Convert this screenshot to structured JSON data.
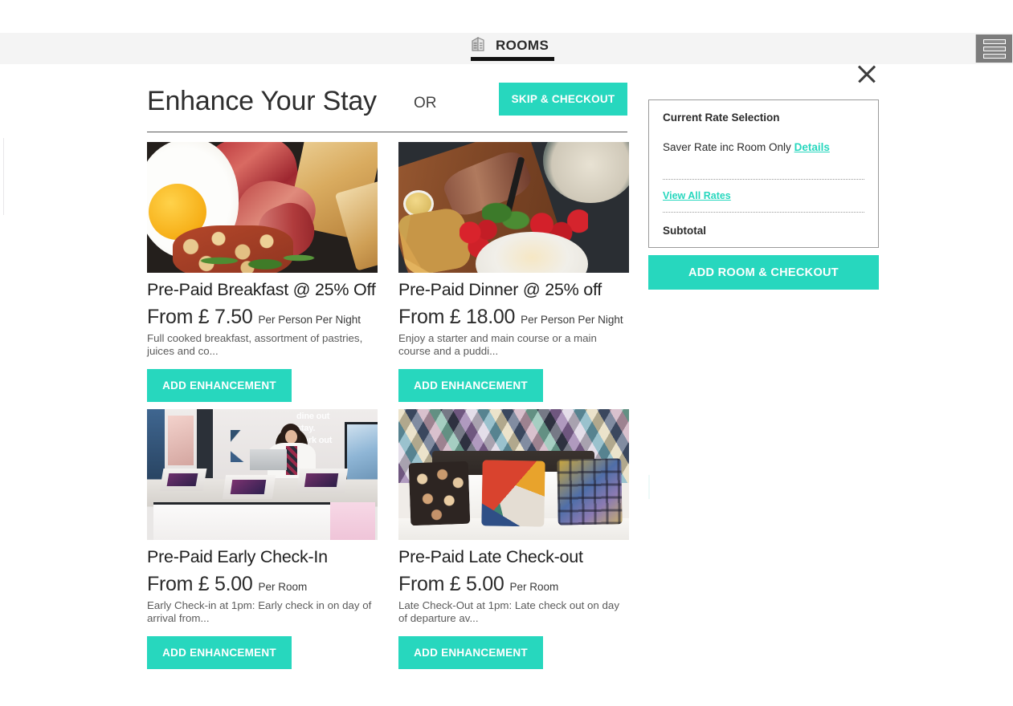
{
  "header": {
    "tab_label": "ROOMS",
    "tab_icon": "building-icon",
    "menu_icon": "hamburger-menu-icon",
    "close_icon": "close-icon"
  },
  "title_section": {
    "heading": "Enhance Your Stay",
    "or_label": "OR",
    "skip_button": "SKIP & CHECKOUT"
  },
  "accent_color": "#27d7be",
  "cards": [
    {
      "title": "Pre-Paid Breakfast @ 25% Off",
      "price": "From £ 7.50",
      "unit": "Per Person Per Night",
      "description": "Full cooked breakfast, assortment of pastries, juices and co...",
      "button": "ADD ENHANCEMENT",
      "image_alt": "cooked-breakfast-photo"
    },
    {
      "title": "Pre-Paid Dinner @ 25% off",
      "price": "From £ 18.00",
      "unit": "Per Person Per Night",
      "description": "Enjoy a starter and main course or a main course and a puddi...",
      "button": "ADD ENHANCEMENT",
      "image_alt": "steak-dinner-photo"
    },
    {
      "title": "Pre-Paid Early Check-In",
      "price": "From £ 5.00",
      "unit": "Per Room",
      "description": "Early Check-in at 1pm: Early check in on day of arrival from...",
      "button": "ADD ENHANCEMENT",
      "image_alt": "hotel-reception-desk-photo"
    },
    {
      "title": "Pre-Paid Late Check-out",
      "price": "From £ 5.00",
      "unit": "Per Room",
      "description": "Late Check-Out at 1pm: Late check out on day of departure av...",
      "button": "ADD ENHANCEMENT",
      "image_alt": "hotel-bed-pillows-photo"
    }
  ],
  "rate_panel": {
    "heading": "Current Rate Selection",
    "rate_name": "Saver Rate inc Room Only",
    "details_link": "Details",
    "view_all_rates": "View All Rates",
    "subtotal_label": "Subtotal",
    "checkout_button": "ADD ROOM & CHECKOUT"
  },
  "reception_wall_text": "dine out\nstay.\nwork out"
}
